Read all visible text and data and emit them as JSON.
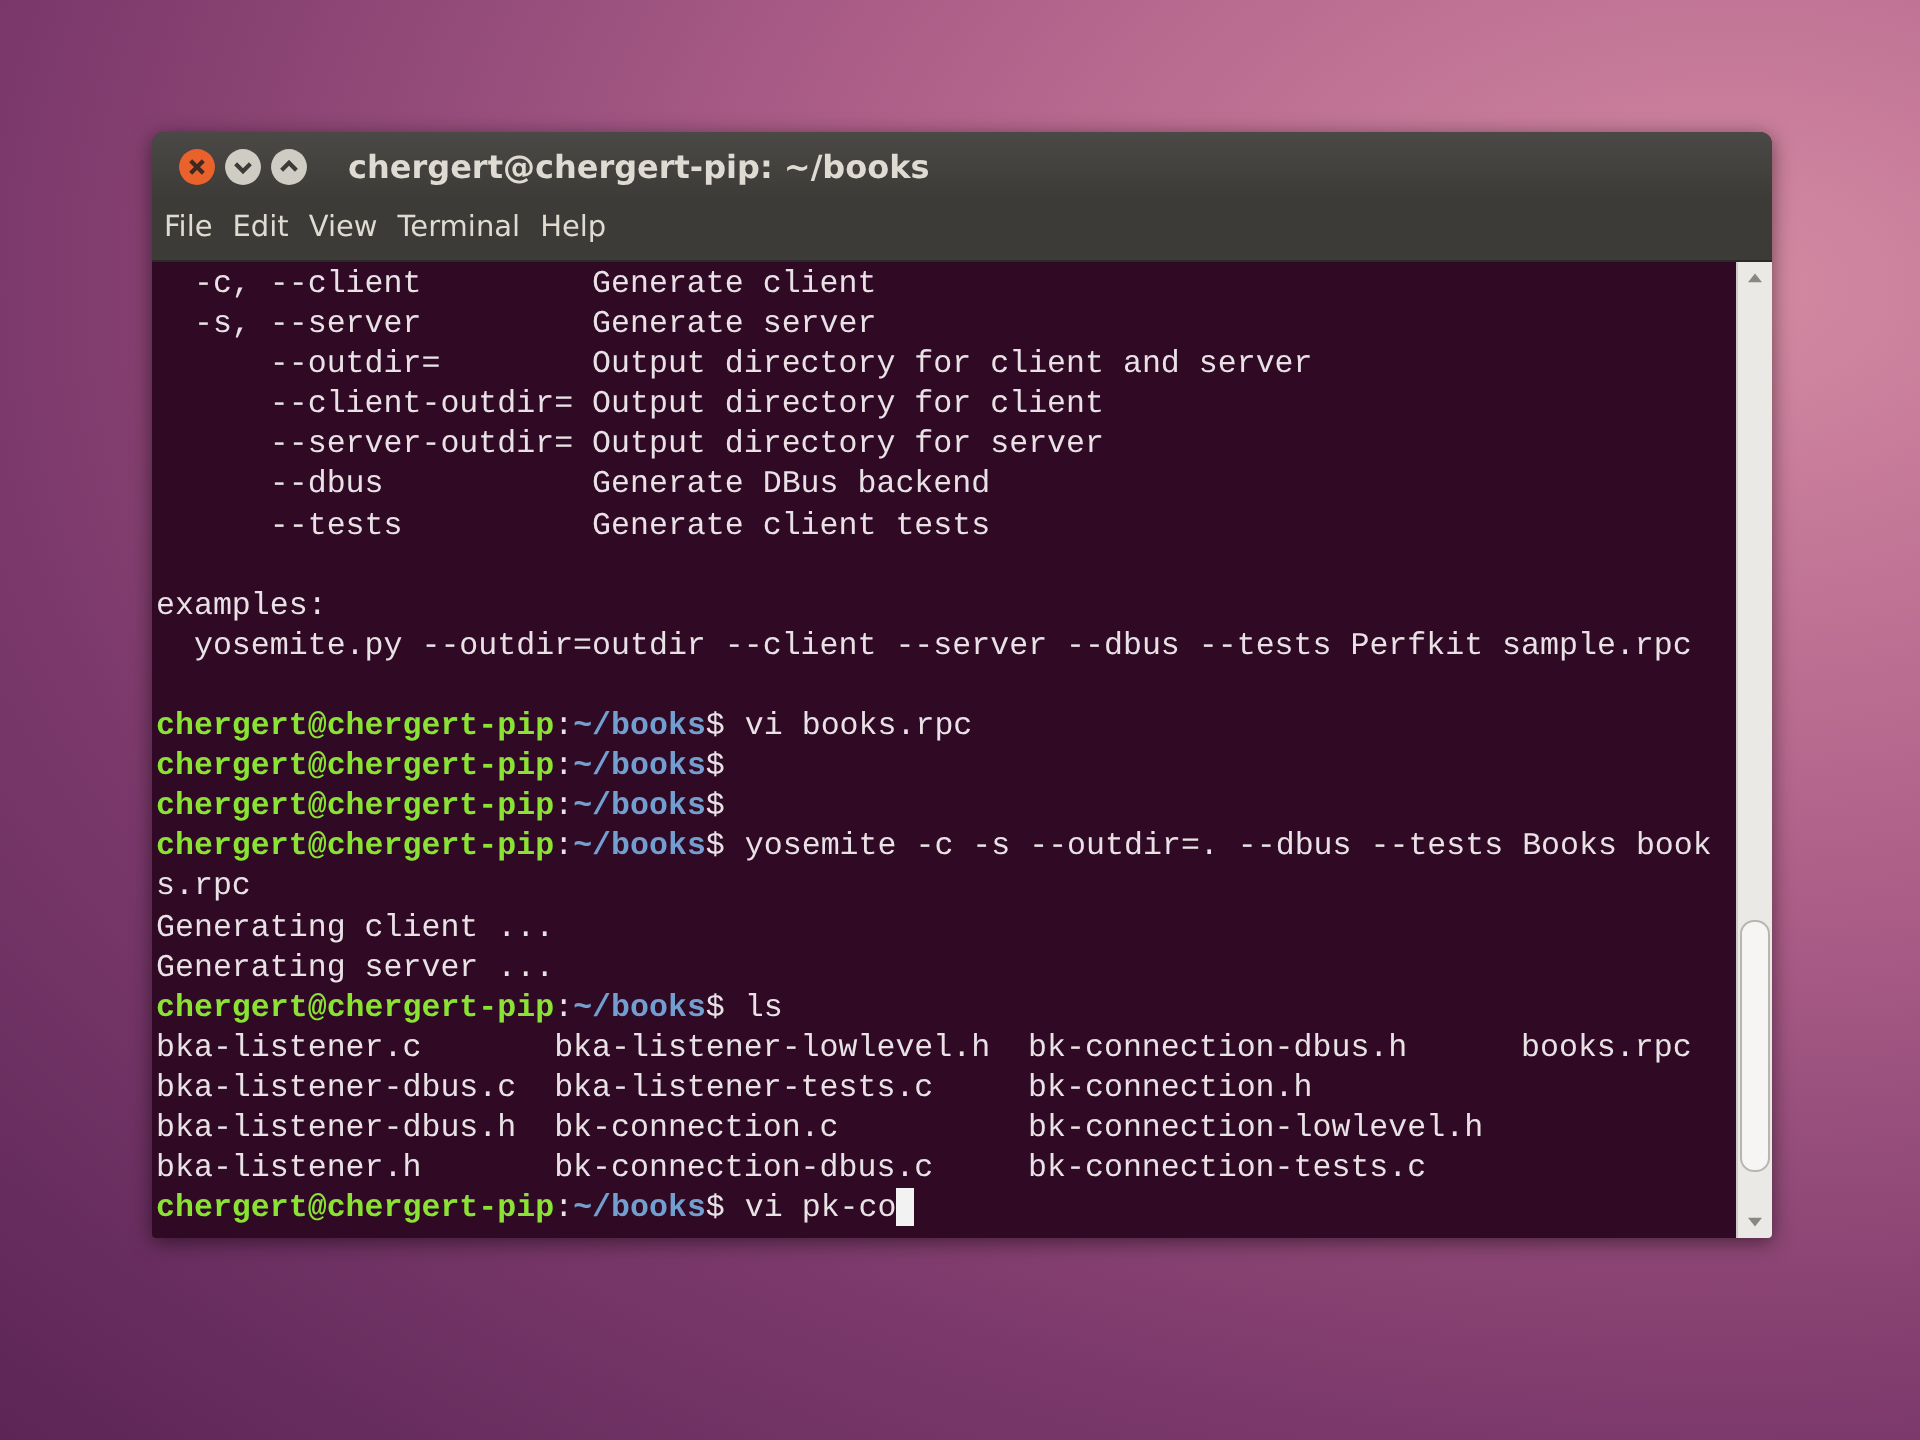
{
  "window": {
    "title": "chergert@chergert-pip: ~/books"
  },
  "menu": [
    {
      "label": "File"
    },
    {
      "label": "Edit"
    },
    {
      "label": "View"
    },
    {
      "label": "Terminal"
    },
    {
      "label": "Help"
    }
  ],
  "terminal": {
    "lines": [
      {
        "kind": "output",
        "text": "  -c, --client         Generate client"
      },
      {
        "kind": "output",
        "text": "  -s, --server         Generate server"
      },
      {
        "kind": "output",
        "text": "      --outdir=        Output directory for client and server"
      },
      {
        "kind": "output",
        "text": "      --client-outdir= Output directory for client"
      },
      {
        "kind": "output",
        "text": "      --server-outdir= Output directory for server"
      },
      {
        "kind": "output",
        "text": "      --dbus           Generate DBus backend"
      },
      {
        "kind": "output",
        "text": "      --tests          Generate client tests"
      },
      {
        "kind": "blank"
      },
      {
        "kind": "output",
        "text": "examples:"
      },
      {
        "kind": "output",
        "text": "  yosemite.py --outdir=outdir --client --server --dbus --tests Perfkit sample.rpc"
      },
      {
        "kind": "blank"
      },
      {
        "kind": "prompt",
        "user": "chergert@chergert-pip",
        "sep": ":",
        "path": "~/books",
        "symbol": "$",
        "command": "vi books.rpc",
        "cursor": false
      },
      {
        "kind": "prompt",
        "user": "chergert@chergert-pip",
        "sep": ":",
        "path": "~/books",
        "symbol": "$",
        "cursor": false
      },
      {
        "kind": "prompt",
        "user": "chergert@chergert-pip",
        "sep": ":",
        "path": "~/books",
        "symbol": "$",
        "cursor": false
      },
      {
        "kind": "prompt",
        "user": "chergert@chergert-pip",
        "sep": ":",
        "path": "~/books",
        "symbol": "$",
        "command": "yosemite -c -s --outdir=. --dbus --tests Books book",
        "cursor": false
      },
      {
        "kind": "output",
        "text": "s.rpc"
      },
      {
        "kind": "output",
        "text": "Generating client ..."
      },
      {
        "kind": "output",
        "text": "Generating server ..."
      },
      {
        "kind": "prompt",
        "user": "chergert@chergert-pip",
        "sep": ":",
        "path": "~/books",
        "symbol": "$",
        "command": "ls",
        "cursor": false
      },
      {
        "kind": "listing",
        "cells": [
          "bka-listener.c",
          "bka-listener-lowlevel.h",
          "bk-connection-dbus.h",
          "books.rpc"
        ]
      },
      {
        "kind": "listing",
        "cells": [
          "bka-listener-dbus.c",
          "bka-listener-tests.c",
          "bk-connection.h"
        ]
      },
      {
        "kind": "listing",
        "cells": [
          "bka-listener-dbus.h",
          "bk-connection.c",
          "bk-connection-lowlevel.h"
        ]
      },
      {
        "kind": "listing",
        "cells": [
          "bka-listener.h",
          "bk-connection-dbus.c",
          "bk-connection-tests.c"
        ]
      },
      {
        "kind": "prompt",
        "user": "chergert@chergert-pip",
        "sep": ":",
        "path": "~/books",
        "symbol": "$",
        "command": "vi pk-co",
        "cursor": true
      }
    ]
  }
}
